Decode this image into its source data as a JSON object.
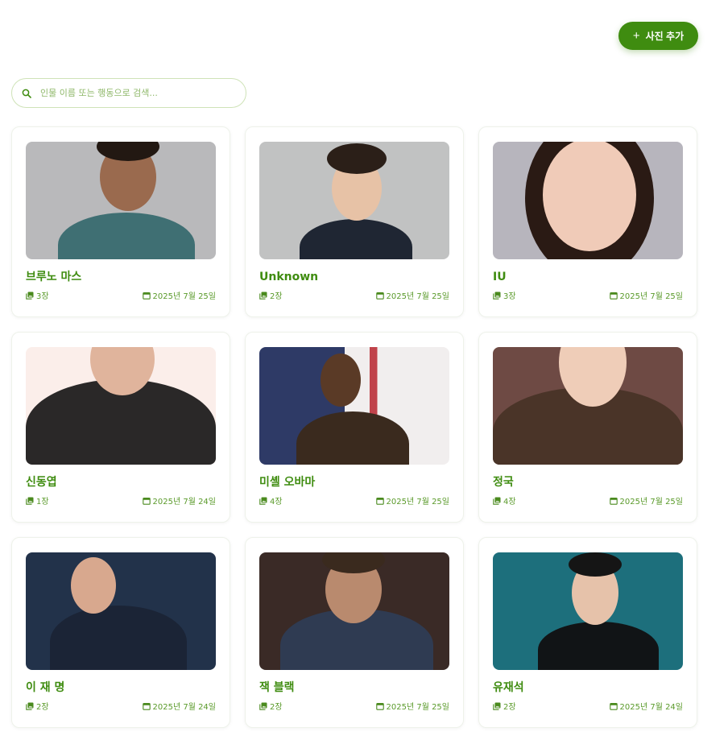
{
  "toolbar": {
    "add_photo_label": "사진 추가"
  },
  "search": {
    "placeholder": "인물 이름 또는 행동으로 검색..."
  },
  "colors": {
    "accent": "#3f8c10"
  },
  "people": [
    {
      "name": "브루노 마스",
      "count": "3장",
      "date": "2025년 7월 25일"
    },
    {
      "name": "Unknown",
      "count": "2장",
      "date": "2025년 7월 25일"
    },
    {
      "name": "IU",
      "count": "3장",
      "date": "2025년 7월 25일"
    },
    {
      "name": "신동엽",
      "count": "1장",
      "date": "2025년 7월 24일"
    },
    {
      "name": "미셸 오바마",
      "count": "4장",
      "date": "2025년 7월 25일"
    },
    {
      "name": "정국",
      "count": "4장",
      "date": "2025년 7월 25일"
    },
    {
      "name": "이 재 명",
      "count": "2장",
      "date": "2025년 7월 24일"
    },
    {
      "name": "잭 블랙",
      "count": "2장",
      "date": "2025년 7월 25일"
    },
    {
      "name": "유재석",
      "count": "2장",
      "date": "2025년 7월 24일"
    }
  ]
}
